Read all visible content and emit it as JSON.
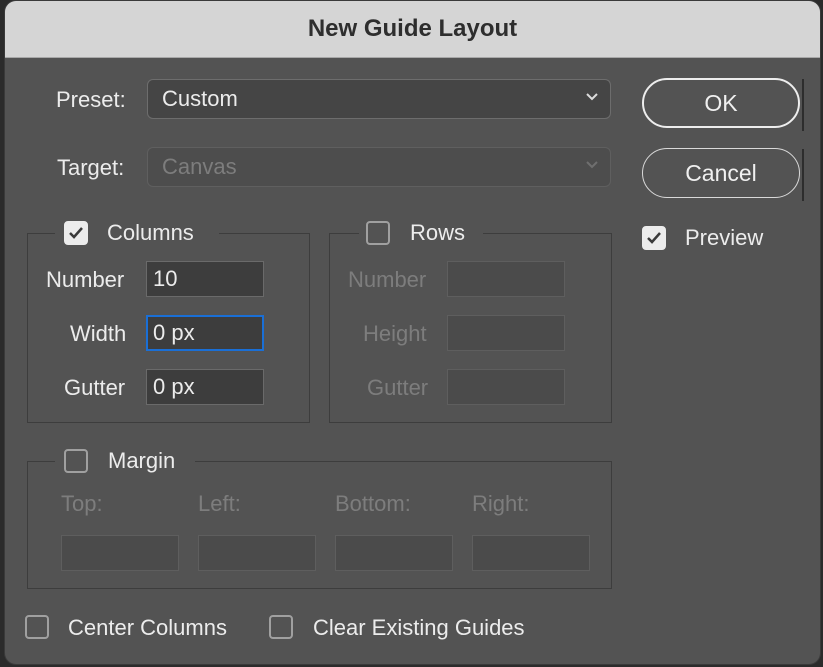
{
  "dialog": {
    "title": "New Guide Layout"
  },
  "preset": {
    "label": "Preset:",
    "value": "Custom"
  },
  "target": {
    "label": "Target:",
    "value": "Canvas"
  },
  "columns": {
    "label": "Columns",
    "checked": true,
    "number_label": "Number",
    "number_value": "10",
    "width_label": "Width",
    "width_value": "0 px",
    "gutter_label": "Gutter",
    "gutter_value": "0 px"
  },
  "rows": {
    "label": "Rows",
    "checked": false,
    "number_label": "Number",
    "height_label": "Height",
    "gutter_label": "Gutter"
  },
  "margin": {
    "label": "Margin",
    "checked": false,
    "top_label": "Top:",
    "left_label": "Left:",
    "bottom_label": "Bottom:",
    "right_label": "Right:"
  },
  "buttons": {
    "ok": "OK",
    "cancel": "Cancel"
  },
  "preview": {
    "label": "Preview",
    "checked": true
  },
  "options": {
    "center_columns": {
      "label": "Center Columns",
      "checked": false
    },
    "clear_existing": {
      "label": "Clear Existing Guides",
      "checked": false
    }
  },
  "colors": {
    "accent_focus": "#1a6fd6",
    "dialog_bg": "#535353",
    "titlebar_bg": "#d5d5d5"
  }
}
